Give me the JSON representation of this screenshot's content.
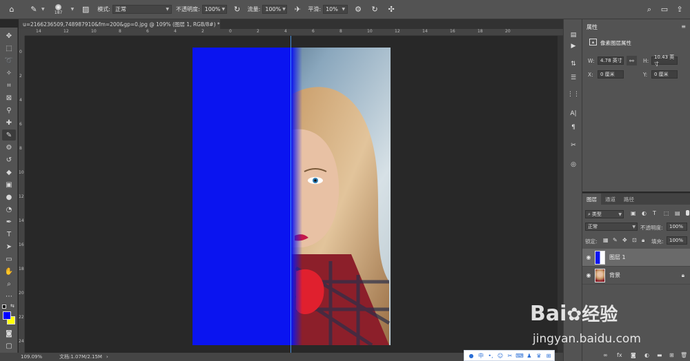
{
  "options_bar": {
    "brush_size": "187",
    "mode_label": "模式:",
    "mode_value": "正常",
    "opacity_label": "不透明度:",
    "opacity_value": "100%",
    "flow_label": "流量:",
    "flow_value": "100%",
    "smoothing_label": "平滑:",
    "smoothing_value": "10%"
  },
  "document": {
    "tab_title": "u=2166236509,748987910&fm=200&gp=0.jpg @ 109% (图层 1, RGB/8#) *",
    "zoom_status": "109.09%",
    "doc_status": "文档:1.07M/2.15M"
  },
  "rulers": {
    "top": [
      "14",
      "12",
      "10",
      "8",
      "6",
      "4",
      "2",
      "0",
      "2",
      "4",
      "6",
      "8",
      "10",
      "12",
      "14",
      "16",
      "18",
      "20"
    ],
    "left": [
      "0",
      "2",
      "4",
      "6",
      "8",
      "10",
      "12",
      "14",
      "16",
      "18",
      "20",
      "22",
      "24"
    ]
  },
  "properties": {
    "tab": "属性",
    "section": "像素图层属性",
    "w_label": "W:",
    "w_value": "4.78 英寸",
    "h_label": "H:",
    "h_value": "10.43 英寸",
    "x_label": "X:",
    "x_value": "0 厘米",
    "y_label": "Y:",
    "y_value": "0 厘米"
  },
  "layers": {
    "tabs": [
      "图层",
      "通道",
      "路径"
    ],
    "kind_filter": "类型",
    "blend_mode": "正常",
    "opacity_label": "不透明度:",
    "opacity_value": "100%",
    "lock_label": "锁定:",
    "fill_label": "填充:",
    "fill_value": "100%",
    "items": [
      {
        "name": "图层 1"
      },
      {
        "name": "背景"
      }
    ]
  },
  "colors": {
    "foreground": "#0000ff",
    "background": "#ffff00",
    "layer_fill": "#0a14f0"
  },
  "watermark": {
    "brand": "Bai",
    "brand_cn": "经验",
    "url": "jingyan.baidu.com"
  }
}
